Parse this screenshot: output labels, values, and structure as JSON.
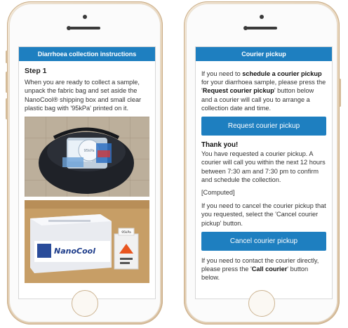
{
  "left_screen": {
    "header": "Diarrhoea collection instructions",
    "step_title": "Step 1",
    "step_text": "When you are ready to collect a sample, unpack the fabric bag and set aside the NanoCool® shipping box and small clear plastic bag with '95kPa' printed on it.",
    "photo1_labels": {
      "bag": "95kPa"
    },
    "photo2_labels": {
      "brand": "NanoCool",
      "bag_print": "95kPa"
    }
  },
  "right_screen": {
    "header": "Courier pickup",
    "intro_pre": "If you need to ",
    "intro_bold": "schedule a courier pickup",
    "intro_mid": " for your diarrhoea sample, please press the '",
    "intro_bold2": "Request courier pickup",
    "intro_post": "' button below and a courier will call you to arrange a collection date and time.",
    "request_button": "Request courier pickup",
    "thanks_title": "Thank you!",
    "thanks_text": "You have requested a courier pickup. A courier will call you within the next 12 hours between 7:30 am and 7:30 pm to confirm and schedule the collection.",
    "computed": "[Computed]",
    "cancel_text": "If you need to cancel the courier pickup that you requested, select the 'Cancel courier pickup' button.",
    "cancel_button": "Cancel courier pickup",
    "contact_pre": "If you need to contact the courier directly, please press the '",
    "contact_bold": "Call courier",
    "contact_post": "' button below."
  },
  "colors": {
    "accent": "#1e7fc0",
    "phone_gold": "#e7d3b8"
  }
}
